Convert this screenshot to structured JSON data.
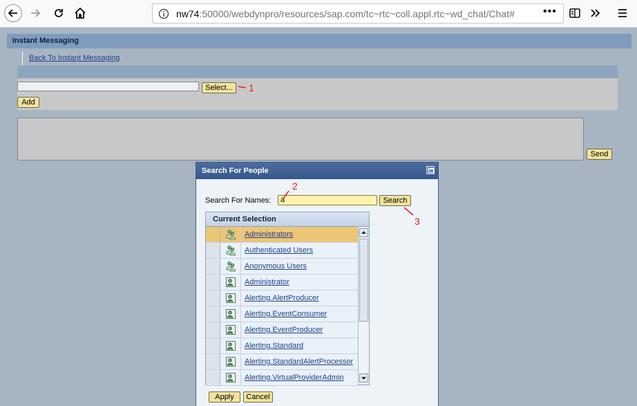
{
  "browser": {
    "url_host": "nw74",
    "url_rest": ":50000/webdynpro/resources/sap.com/tc~rtc~coll.appl.rtc~wd_chat/Chat#",
    "url_menu": "•••"
  },
  "page": {
    "title": "Instant Messaging",
    "back_link": "Back To Instant Messaging",
    "select_button": "Select...",
    "add_button": "Add",
    "send_button": "Send"
  },
  "dialog": {
    "title": "Search For People",
    "search_label": "Search For Names:",
    "search_value": "a",
    "search_button": "Search",
    "column_header": "Current Selection",
    "rows": [
      {
        "label": "Administrators",
        "type": "group",
        "selected": true
      },
      {
        "label": "Authenticated Users",
        "type": "group",
        "selected": false
      },
      {
        "label": "Anonymous Users",
        "type": "group",
        "selected": false
      },
      {
        "label": "Administrator",
        "type": "user",
        "selected": false
      },
      {
        "label": "Alerting.AlertProducer",
        "type": "user",
        "selected": false
      },
      {
        "label": "Alerting.EventConsumer",
        "type": "user",
        "selected": false
      },
      {
        "label": "Alerting.EventProducer",
        "type": "user",
        "selected": false
      },
      {
        "label": "Alerting.Standard",
        "type": "user",
        "selected": false
      },
      {
        "label": "Alerting.StandardAlertProcessor",
        "type": "user",
        "selected": false
      },
      {
        "label": "Alerting.VirtualProviderAdmin",
        "type": "user",
        "selected": false
      }
    ],
    "apply_button": "Apply",
    "cancel_button": "Cancel"
  },
  "annotations": {
    "one": "1",
    "two": "2",
    "three": "3",
    "color": "#e41b1b"
  }
}
